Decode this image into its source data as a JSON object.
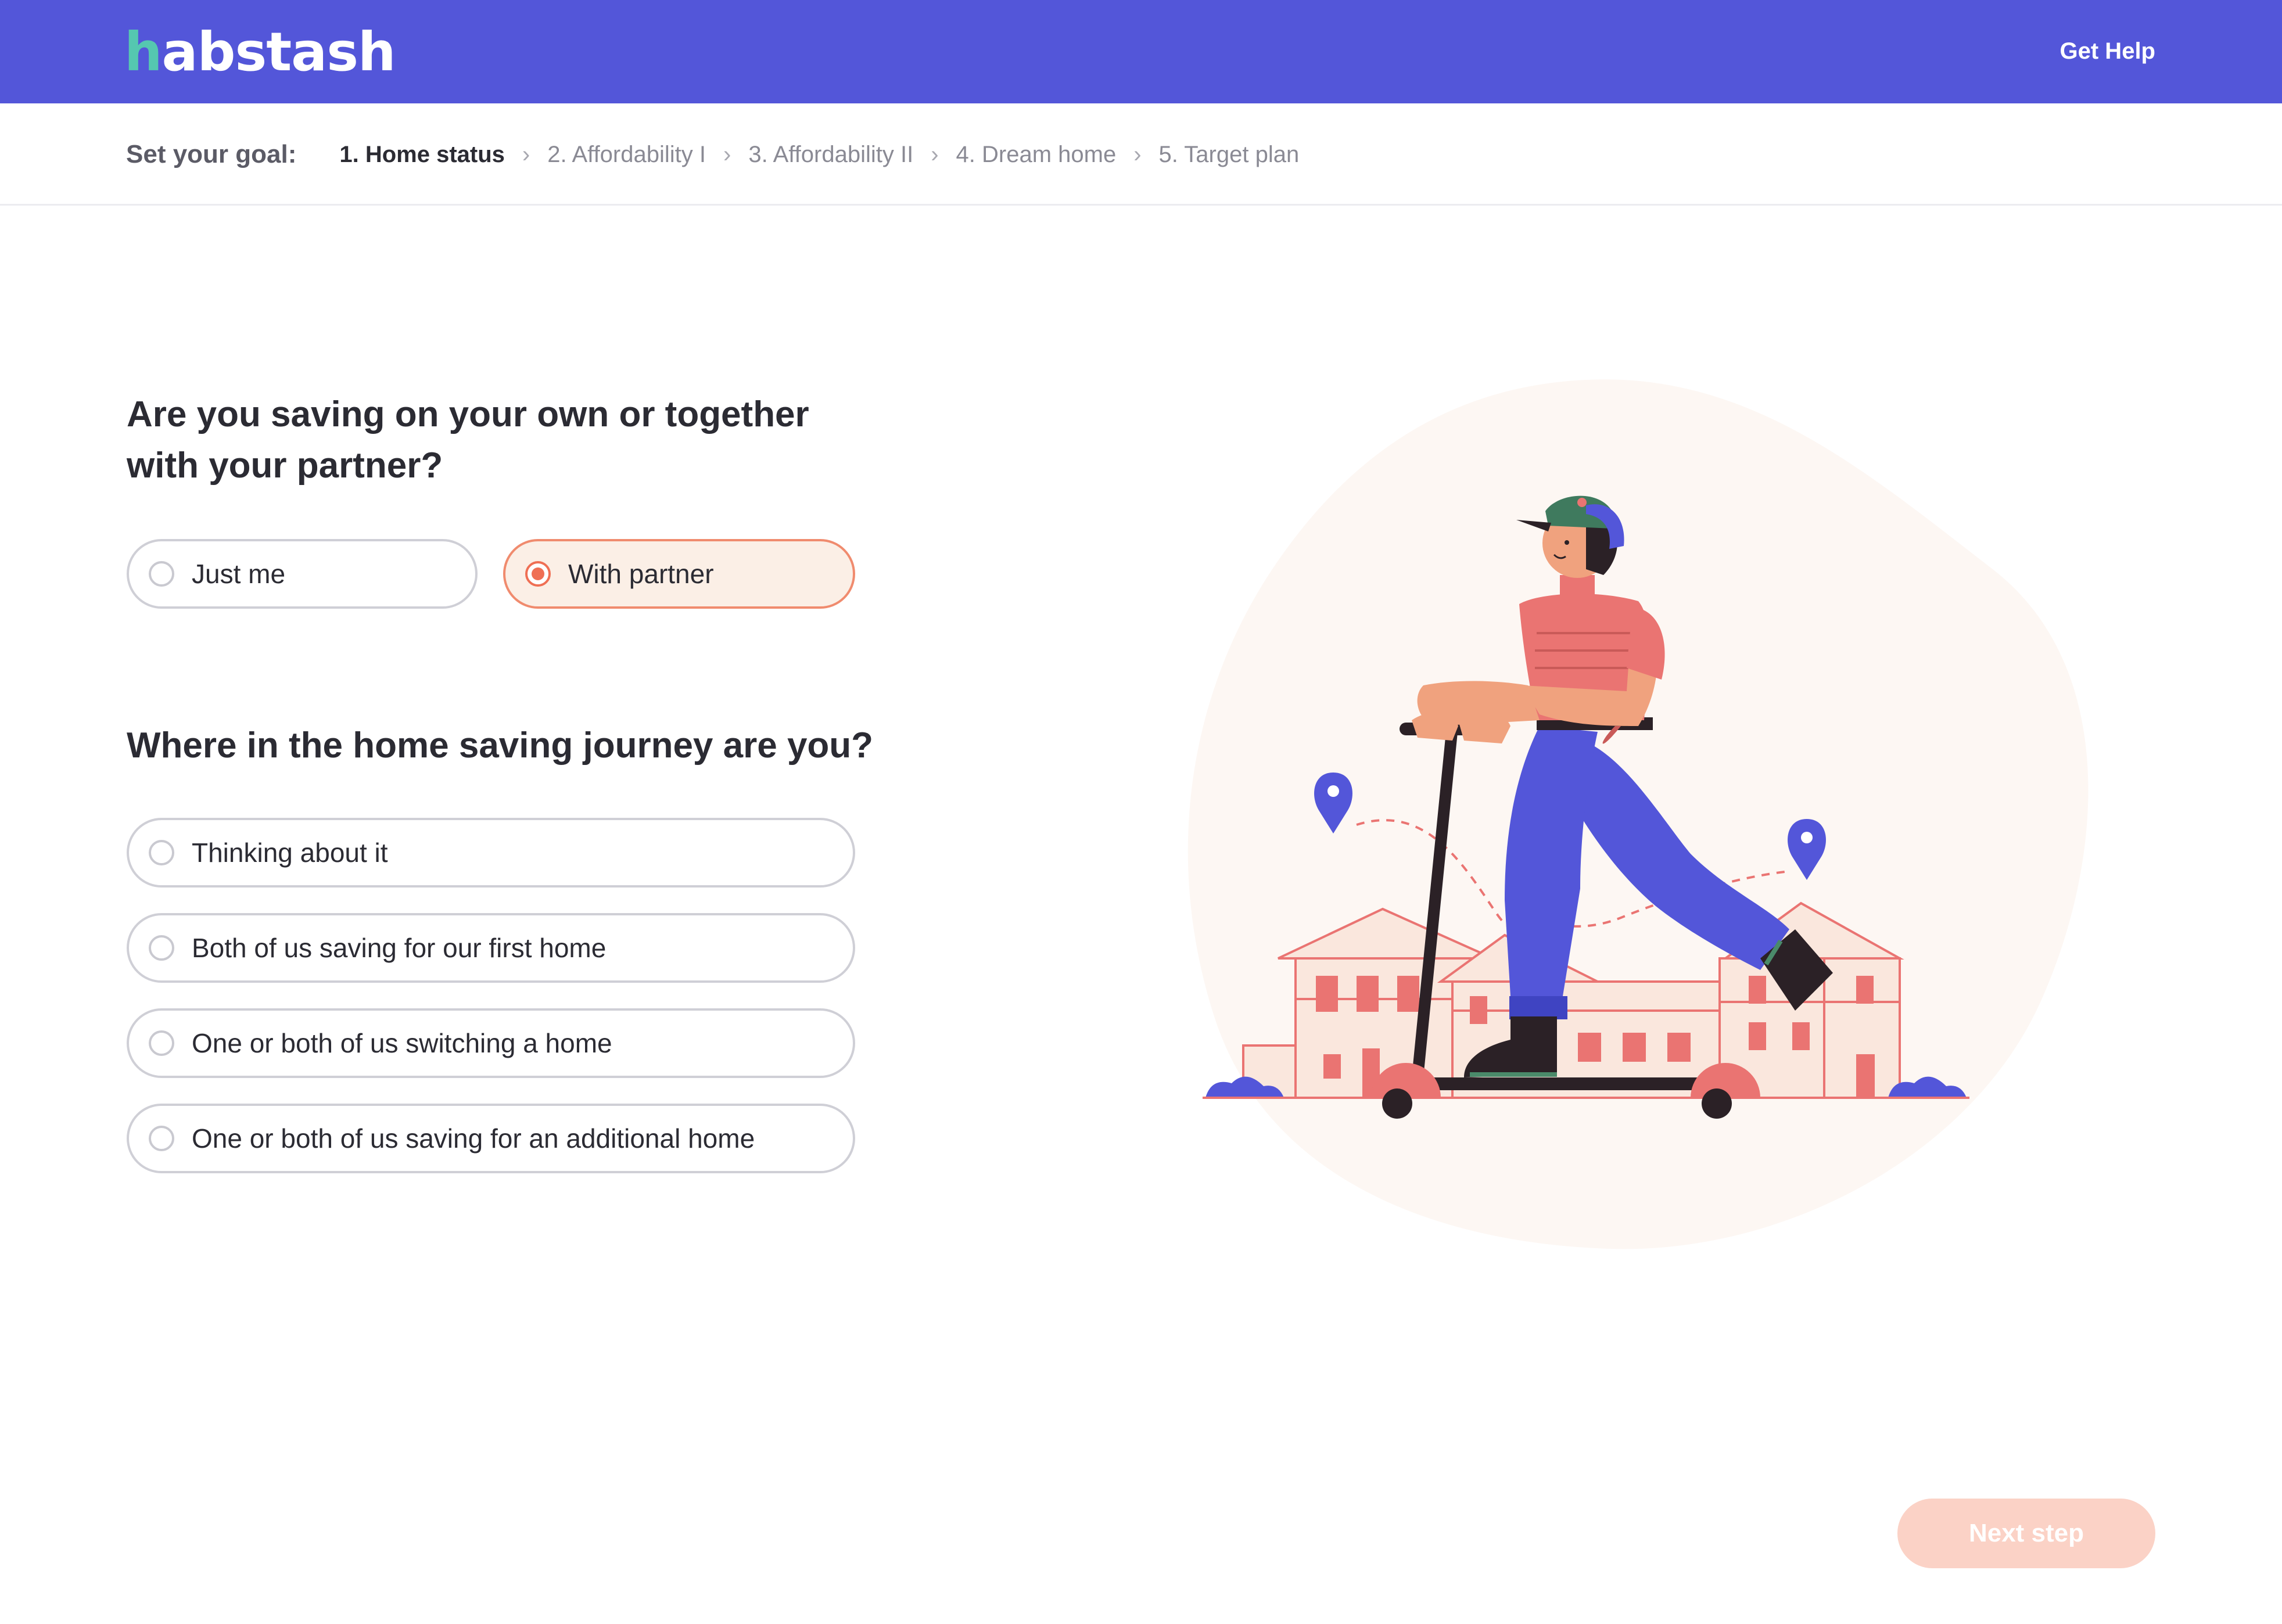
{
  "header": {
    "logo_h": "h",
    "logo_rest": "abstash",
    "help_label": "Get Help"
  },
  "steps": {
    "label": "Set your goal:",
    "items": [
      "1. Home status",
      "2. Affordability I",
      "3. Affordability II",
      "4. Dream home",
      "5. Target plan"
    ],
    "active_index": 0
  },
  "question1": {
    "title": "Are you saving on your own or together with your partner?",
    "options": [
      "Just me",
      "With partner"
    ],
    "selected": "With partner"
  },
  "question2": {
    "title": "Where in the home saving journey are you?",
    "options": [
      "Thinking about it",
      "Both of us saving for our first home",
      "One or both of us switching a home",
      "One or both of us saving for an additional home"
    ],
    "selected": null
  },
  "footer": {
    "next_label": "Next step"
  },
  "illustration": {
    "name": "person-riding-scooter-past-houses"
  },
  "colors": {
    "brand": "#5356d9",
    "accent": "#ef6f54",
    "selected_bg": "#fbefe6",
    "logo_accent": "#55c7b0"
  }
}
